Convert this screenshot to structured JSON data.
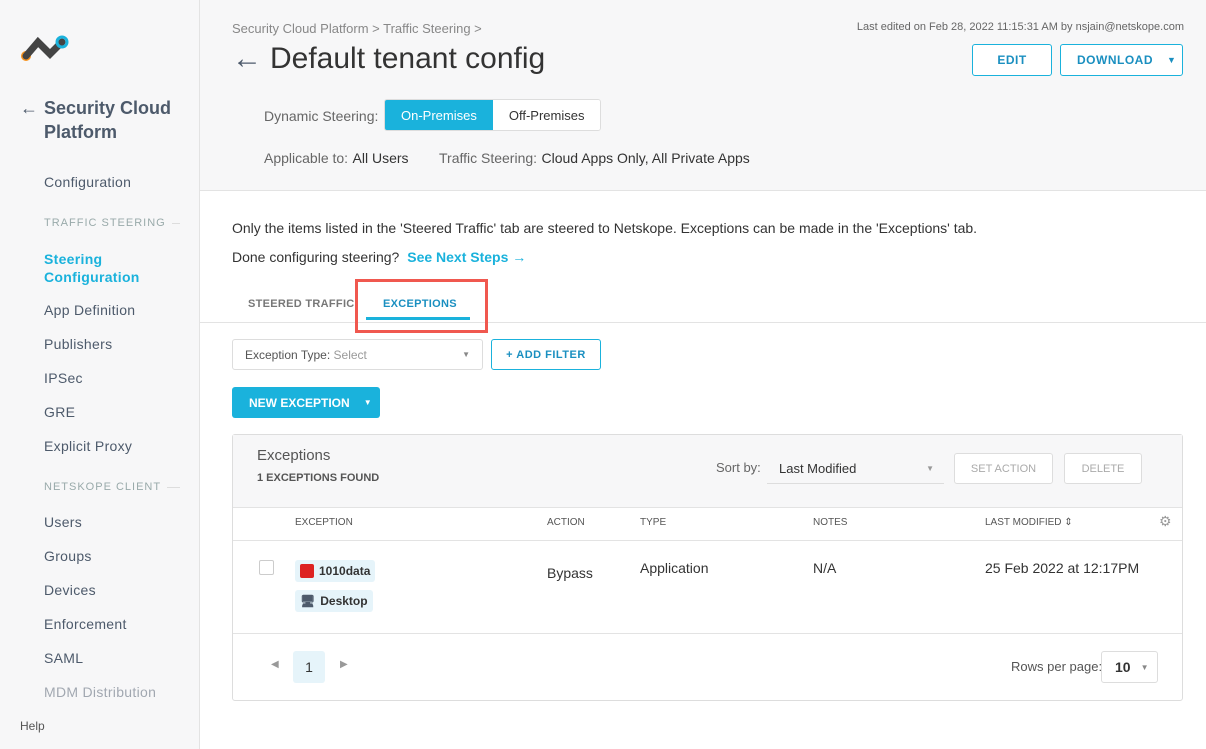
{
  "sidebar": {
    "title": "Security Cloud Platform",
    "items": {
      "configuration": "Configuration",
      "traffic_section": "TRAFFIC STEERING",
      "steering": "Steering Configuration",
      "app_def": "App Definition",
      "publishers": "Publishers",
      "ipsec": "IPSec",
      "gre": "GRE",
      "explicit_proxy": "Explicit Proxy",
      "client_section": "NETSKOPE CLIENT",
      "users": "Users",
      "groups": "Groups",
      "devices": "Devices",
      "enforcement": "Enforcement",
      "saml": "SAML",
      "mdm": "MDM Distribution"
    },
    "help": "Help"
  },
  "header": {
    "breadcrumb": "Security Cloud Platform > Traffic Steering >",
    "title": "Default tenant config",
    "last_edited": "Last edited on Feb 28, 2022 11:15:31 AM by nsjain@netskope.com",
    "edit": "EDIT",
    "download": "DOWNLOAD",
    "dynamic_label": "Dynamic Steering:",
    "on_prem": "On-Premises",
    "off_prem": "Off-Premises",
    "applicable_label": "Applicable to:",
    "applicable_value": "All Users",
    "steering_label": "Traffic Steering:",
    "steering_value": "Cloud Apps Only, All Private Apps"
  },
  "main": {
    "info": "Only the items listed in the 'Steered Traffic' tab are steered to Netskope. Exceptions can be made in the 'Exceptions' tab.",
    "done": "Done configuring steering?",
    "next_steps": "See Next Steps →",
    "tabs": [
      "STEERED TRAFFIC",
      "EXCEPTIONS"
    ],
    "filter_label": "Exception Type:",
    "filter_placeholder": "Select",
    "add_filter": "+ ADD FILTER",
    "new_exception": "NEW EXCEPTION"
  },
  "table": {
    "title": "Exceptions",
    "count": "1 EXCEPTIONS FOUND",
    "sort_label": "Sort by:",
    "sort_value": "Last Modified",
    "set_action": "SET ACTION",
    "delete": "DELETE",
    "columns": [
      "EXCEPTION",
      "ACTION",
      "TYPE",
      "NOTES",
      "LAST MODIFIED"
    ],
    "rows": [
      {
        "app": "1010data",
        "platform": "Desktop",
        "action": "Bypass",
        "type": "Application",
        "notes": "N/A",
        "modified": "25 Feb 2022 at 12:17PM"
      }
    ],
    "page": "1",
    "rows_label": "Rows per page:",
    "rows_value": "10"
  },
  "colors": {
    "accent": "#1ab2dc",
    "highlight": "#f0584f"
  }
}
